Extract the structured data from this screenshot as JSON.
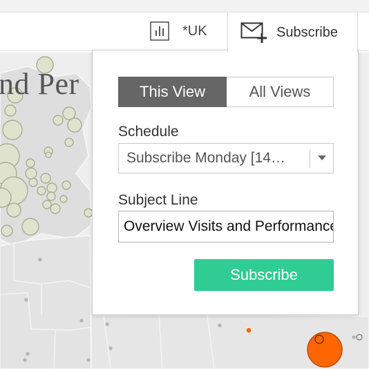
{
  "toolbar": {
    "metric_icon": "bar-chart-icon",
    "metric_label": "*UK",
    "subscribe_icon": "envelope-plus-icon",
    "subscribe_label": "Subscribe"
  },
  "background": {
    "dashboard_title": "nd Per",
    "highlight_color": "#ff6600",
    "bubble_color": "#dfe2cc"
  },
  "dialog": {
    "tabs": [
      {
        "label": "This View",
        "active": true
      },
      {
        "label": "All Views",
        "active": false
      }
    ],
    "schedule_label": "Schedule",
    "schedule_value": "Subscribe Monday [14…",
    "subject_label": "Subject Line",
    "subject_value": "Overview Visits and Performance",
    "submit_label": "Subscribe",
    "accent_color": "#2fcc94"
  }
}
